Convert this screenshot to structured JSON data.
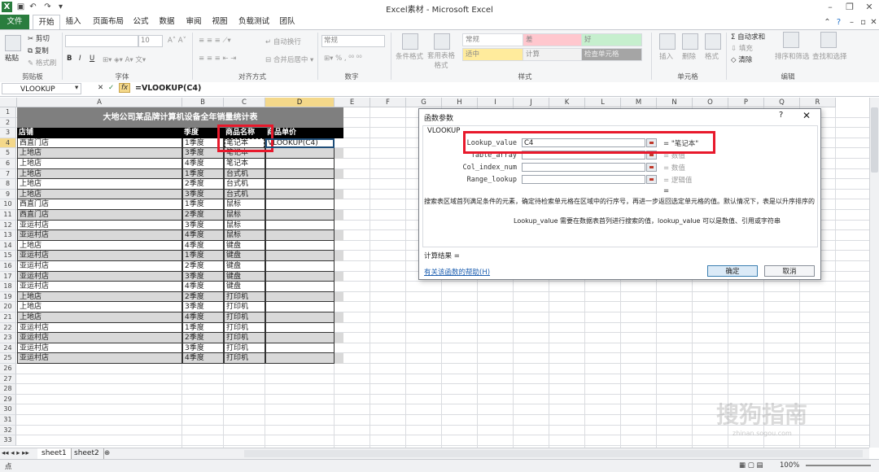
{
  "window": {
    "title": "Excel素材 - Microsoft Excel",
    "controls": [
      "–",
      "❐",
      "✕"
    ]
  },
  "ribbon_tabs": [
    "文件",
    "开始",
    "插入",
    "页面布局",
    "公式",
    "数据",
    "审阅",
    "视图",
    "负载测试",
    "团队"
  ],
  "ribbon": {
    "clipboard": {
      "paste": "粘贴",
      "cut": "剪切",
      "copy": "复制",
      "format_painter": "格式刷",
      "label": "剪贴板"
    },
    "font": {
      "size": "10",
      "label": "字体",
      "bold": "B",
      "italic": "I",
      "underline": "U"
    },
    "alignment": {
      "wrap": "自动换行",
      "merge": "合并后居中",
      "label": "对齐方式"
    },
    "number": {
      "format": "常规",
      "label": "数字",
      "percent": "%"
    },
    "styles": {
      "conditional": "条件格式",
      "table_format": "套用表格格式",
      "cells": [
        "常规",
        "差",
        "好",
        "适中",
        "计算",
        "检查单元格"
      ],
      "label": "样式"
    },
    "cells": {
      "insert": "插入",
      "delete": "删除",
      "format": "格式",
      "label": "单元格"
    },
    "editing": {
      "autosum": "Σ 自动求和",
      "fill": "填充",
      "clear": "清除",
      "sort": "排序和筛选",
      "find": "查找和选择",
      "label": "编辑"
    }
  },
  "formula_bar": {
    "name_box": "VLOOKUP",
    "formula": "=VLOOKUP(C4)",
    "fx": "fx"
  },
  "columns": [
    "A",
    "B",
    "C",
    "D",
    "E",
    "F",
    "G",
    "H",
    "I",
    "J",
    "K",
    "L",
    "M",
    "N",
    "O",
    "P",
    "Q",
    "R"
  ],
  "sheet": {
    "title": "大地公司某品牌计算机设备全年销量统计表",
    "headers": [
      "店铺",
      "季度",
      "商品名称",
      "商品单价"
    ],
    "rows": [
      [
        "西直门店",
        "1季度",
        "笔记本",
        "VLOOKUP(C4)"
      ],
      [
        "上地店",
        "3季度",
        "笔记本",
        ""
      ],
      [
        "上地店",
        "4季度",
        "笔记本",
        ""
      ],
      [
        "上地店",
        "1季度",
        "台式机",
        ""
      ],
      [
        "上地店",
        "2季度",
        "台式机",
        ""
      ],
      [
        "上地店",
        "3季度",
        "台式机",
        ""
      ],
      [
        "西直门店",
        "1季度",
        "鼠标",
        ""
      ],
      [
        "西直门店",
        "2季度",
        "鼠标",
        ""
      ],
      [
        "亚运村店",
        "3季度",
        "鼠标",
        ""
      ],
      [
        "亚运村店",
        "4季度",
        "鼠标",
        ""
      ],
      [
        "上地店",
        "4季度",
        "键盘",
        ""
      ],
      [
        "亚运村店",
        "1季度",
        "键盘",
        ""
      ],
      [
        "亚运村店",
        "2季度",
        "键盘",
        ""
      ],
      [
        "亚运村店",
        "3季度",
        "键盘",
        ""
      ],
      [
        "亚运村店",
        "4季度",
        "键盘",
        ""
      ],
      [
        "上地店",
        "2季度",
        "打印机",
        ""
      ],
      [
        "上地店",
        "3季度",
        "打印机",
        ""
      ],
      [
        "上地店",
        "4季度",
        "打印机",
        ""
      ],
      [
        "亚运村店",
        "1季度",
        "打印机",
        ""
      ],
      [
        "亚运村店",
        "2季度",
        "打印机",
        ""
      ],
      [
        "亚运村店",
        "3季度",
        "打印机",
        ""
      ],
      [
        "亚运村店",
        "4季度",
        "打印机",
        ""
      ]
    ],
    "row_numbers": [
      "1",
      "2",
      "3",
      "4",
      "5",
      "6",
      "7",
      "8",
      "9",
      "10",
      "11",
      "12",
      "13",
      "14",
      "15",
      "16",
      "17",
      "18",
      "19",
      "20",
      "21",
      "22",
      "23",
      "24",
      "25",
      "26",
      "27",
      "28",
      "29",
      "30",
      "31",
      "32",
      "33"
    ]
  },
  "sheet_tabs": [
    "sheet1",
    "sheet2"
  ],
  "status": {
    "mode": "点",
    "zoom": "100%"
  },
  "dialog": {
    "title": "函数参数",
    "help_glyph": "?",
    "close_glyph": "✕",
    "function_name": "VLOOKUP",
    "args": [
      {
        "label": "Lookup_value",
        "value": "C4",
        "result": "= \"笔记本\""
      },
      {
        "label": "Table_array",
        "value": "",
        "result": "= 数值"
      },
      {
        "label": "Col_index_num",
        "value": "",
        "result": "= 数值"
      },
      {
        "label": "Range_lookup",
        "value": "",
        "result": "= 逻辑值"
      }
    ],
    "eq": "=",
    "description": "搜索表区域首列满足条件的元素，确定待检索单元格在区域中的行序号，再进一步返回选定单元格的值。默认情况下，表是以升序排序的",
    "arg_help": "Lookup_value  需要在数据表首列进行搜索的值，lookup_value 可以是数值、引用或字符串",
    "calc_result": "计算结果 =",
    "help_link": "有关该函数的帮助(H)",
    "ok": "确定",
    "cancel": "取消"
  },
  "watermark": {
    "text": "搜狗指南",
    "url": "zhinan.sogou.com"
  },
  "colors": {
    "accent": "#2a7d3e",
    "highlight": "#e8192c",
    "selected_header": "#f4d88a",
    "title_band": "#7f7f7f"
  }
}
